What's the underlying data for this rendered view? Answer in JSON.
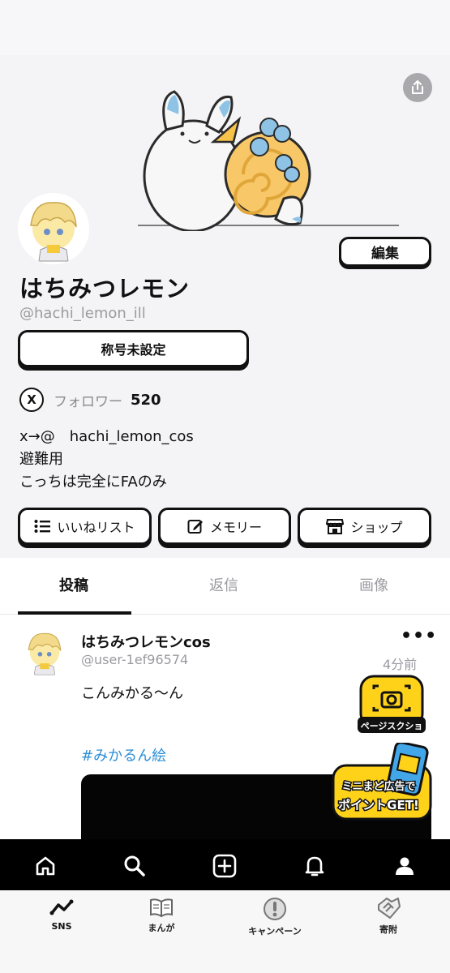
{
  "profile": {
    "display_name": "はちみつレモン",
    "handle": "@hachi_lemon_ill",
    "edit_label": "編集",
    "title_label": "称号未設定",
    "follower_badge": "X",
    "follower_label": "フォロワー",
    "follower_count": "520",
    "bio": [
      "x→@　hachi_lemon_cos",
      "避難用",
      "こっちは完全にFAのみ"
    ],
    "actions": {
      "likes_label": "いいねリスト",
      "memory_label": "メモリー",
      "shop_label": "ショップ"
    }
  },
  "tabs": [
    {
      "label": "投稿",
      "active": true
    },
    {
      "label": "返信",
      "active": false
    },
    {
      "label": "画像",
      "active": false
    }
  ],
  "post": {
    "author_name": "はちみつレモンcos",
    "author_handle": "@user-1ef96574",
    "more": "•••",
    "time": "4分前",
    "text": "こんみかる〜ん",
    "hashtag": "#みかるん絵"
  },
  "floating": {
    "screenshot_label": "ページスクショ",
    "ad_line1": "ミニまど広告で",
    "ad_line2": "ポイントGET!"
  },
  "bottom_nav": {
    "icons": [
      "home-icon",
      "search-icon",
      "add-post-icon",
      "bell-icon",
      "profile-icon"
    ]
  },
  "app_tabs": [
    {
      "label": "SNS",
      "icon": "sns-chart-icon",
      "selected": true
    },
    {
      "label": "まんが",
      "icon": "book-icon",
      "selected": false
    },
    {
      "label": "キャンペーン",
      "icon": "exclamation-icon",
      "selected": false
    },
    {
      "label": "寄附",
      "icon": "handshake-icon",
      "selected": false
    }
  ],
  "colors": {
    "accent_yellow": "#ffd21a",
    "link_blue": "#2e8fd6",
    "text_gray": "#9a9aa0"
  }
}
